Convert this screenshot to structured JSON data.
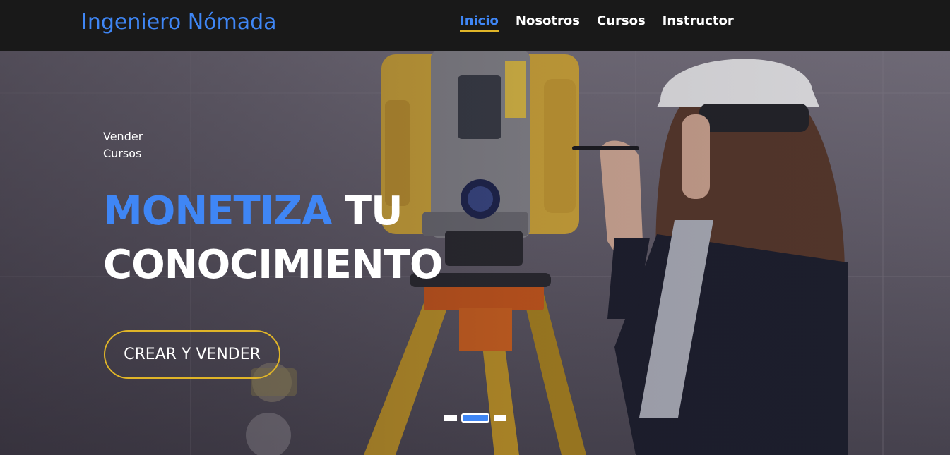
{
  "brand": {
    "name": "Ingeniero Nómada"
  },
  "nav": {
    "items": [
      {
        "label": "Inicio",
        "active": true
      },
      {
        "label": "Nosotros",
        "active": false
      },
      {
        "label": "Cursos",
        "active": false
      },
      {
        "label": "Instructor",
        "active": false
      }
    ]
  },
  "hero": {
    "eyebrow_line1": "Vender",
    "eyebrow_line2": "Cursos",
    "headline_accent": "MONETIZA",
    "headline_rest": " TU",
    "headline_line2": "CONOCIMIENTO",
    "cta_label": "CREAR Y VENDER"
  },
  "carousel": {
    "slides": 3,
    "active_index": 1
  },
  "colors": {
    "accent": "#3f86f5",
    "highlight": "#e0b528",
    "nav_bg": "#191919",
    "text": "#ffffff"
  }
}
